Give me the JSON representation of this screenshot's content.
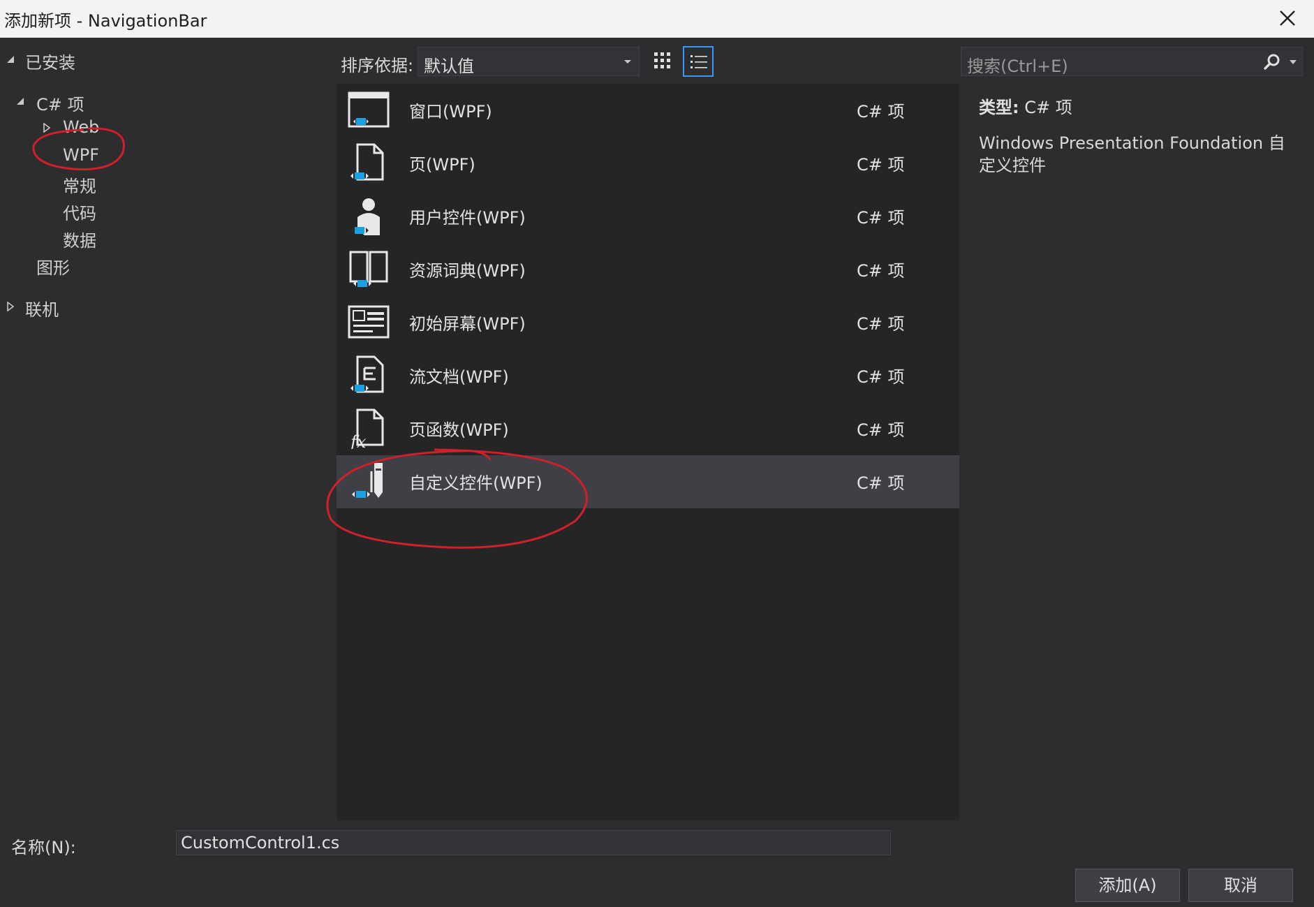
{
  "window": {
    "title": "添加新项 - NavigationBar"
  },
  "tree": {
    "installed": "已安装",
    "csharp": "C# 项",
    "web": "Web",
    "wpf": "WPF",
    "general": "常规",
    "code": "代码",
    "data": "数据",
    "graphics": "图形",
    "online": "联机"
  },
  "toolbar": {
    "sort_label": "排序依据:",
    "sort_value": "默认值",
    "search_placeholder": "搜索(Ctrl+E)"
  },
  "templates": [
    {
      "name": "窗口(WPF)",
      "lang": "C# 项",
      "icon": "window-icon"
    },
    {
      "name": "页(WPF)",
      "lang": "C# 项",
      "icon": "page-icon"
    },
    {
      "name": "用户控件(WPF)",
      "lang": "C# 项",
      "icon": "user-control-icon"
    },
    {
      "name": "资源词典(WPF)",
      "lang": "C# 项",
      "icon": "resource-dictionary-icon"
    },
    {
      "name": "初始屏幕(WPF)",
      "lang": "C# 项",
      "icon": "splash-screen-icon"
    },
    {
      "name": "流文档(WPF)",
      "lang": "C# 项",
      "icon": "flow-document-icon"
    },
    {
      "name": "页函数(WPF)",
      "lang": "C# 项",
      "icon": "page-function-icon"
    },
    {
      "name": "自定义控件(WPF)",
      "lang": "C# 项",
      "icon": "custom-control-icon"
    }
  ],
  "selected_index": 7,
  "details": {
    "type_label": "类型:",
    "type_value": "C# 项",
    "description": "Windows Presentation Foundation 自定义控件"
  },
  "footer": {
    "name_label": "名称(N):",
    "name_value": "CustomControl1.cs",
    "add_button": "添加(A)",
    "cancel_button": "取消"
  },
  "colors": {
    "background": "#2d2d30",
    "list_background": "#252526",
    "selected_row": "#3f3f46",
    "accent": "#3399ff",
    "annotation": "#d0202a",
    "icon_blue": "#1ba1e2"
  }
}
